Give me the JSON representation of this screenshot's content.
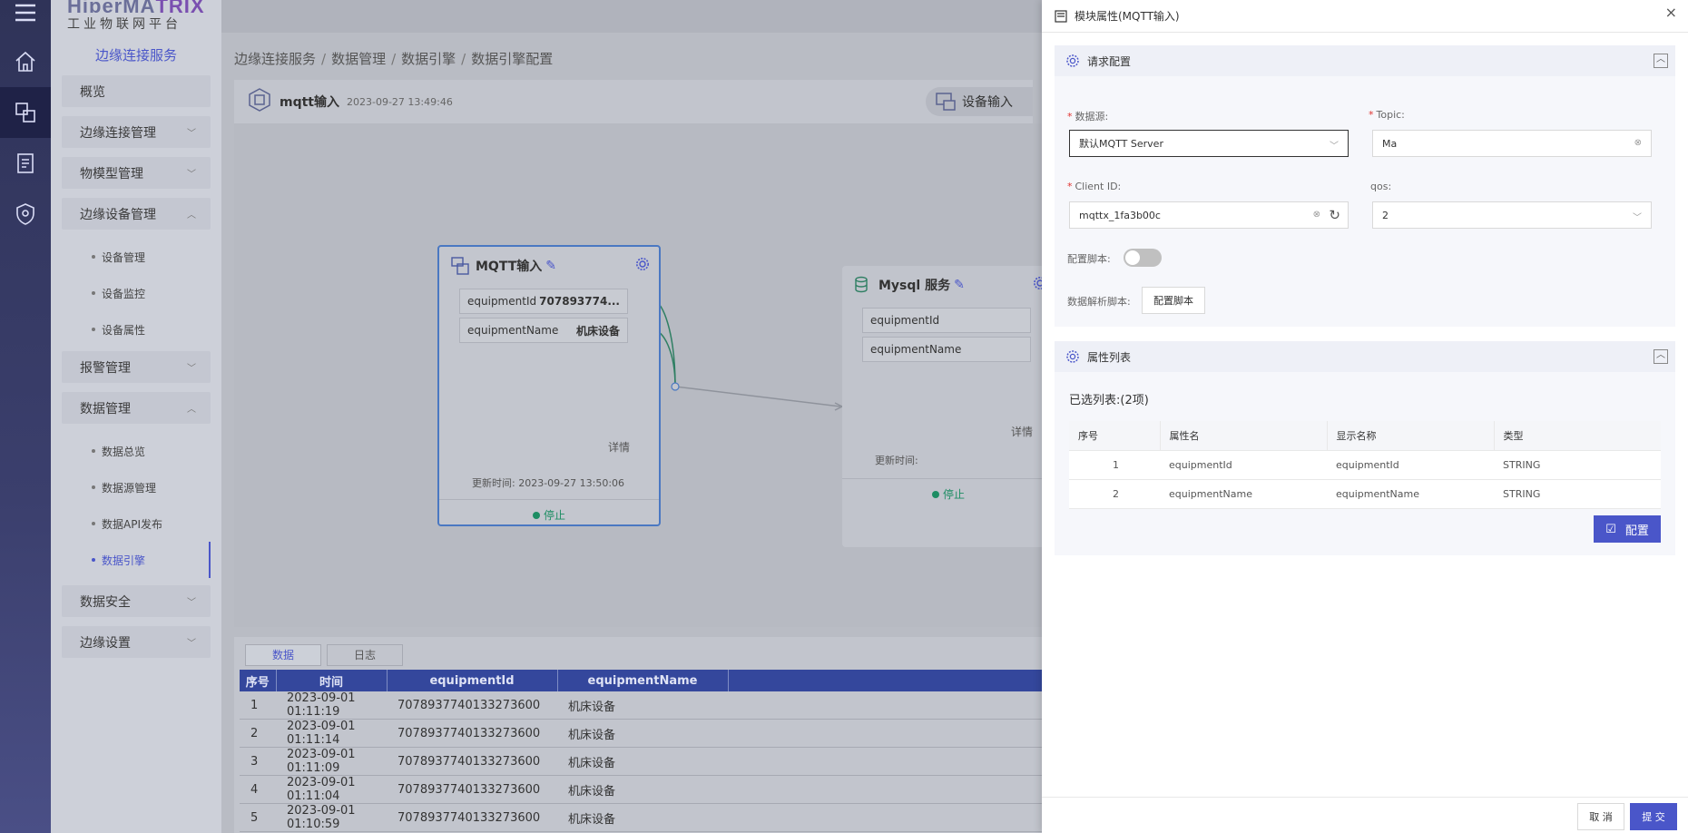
{
  "brand": {
    "logo_a": "HiperMA",
    "logo_b": "TRIX",
    "subtitle": "工业物联网平台"
  },
  "menu": {
    "title": "边缘连接服务",
    "overview": "概览",
    "edge_conn": "边缘连接管理",
    "model": "物模型管理",
    "edge_device": "边缘设备管理",
    "device_mgmt": "设备管理",
    "device_monitor": "设备监控",
    "device_attr": "设备属性",
    "alarm": "报警管理",
    "data": "数据管理",
    "data_overview": "数据总览",
    "datasource": "数据源管理",
    "api": "数据API发布",
    "engine": "数据引擎",
    "security": "数据安全",
    "edge_settings": "边缘设置"
  },
  "breadcrumb": [
    "边缘连接服务",
    "数据管理",
    "数据引擎",
    "数据引擎配置"
  ],
  "breadcrumb_sep": "/",
  "flow": {
    "name": "mqtt输入",
    "time": "2023-09-27 13:49:46",
    "device_btn": "设备输入"
  },
  "mqtt_node": {
    "title": "MQTT输入",
    "rows": [
      {
        "k": "equipmentId",
        "v": "707893774..."
      },
      {
        "k": "equipmentName",
        "v": "机床设备"
      }
    ],
    "detail": "详情",
    "updated_label": "更新时间:",
    "updated": "2023-09-27 13:50:06",
    "status": "停止"
  },
  "mysql_node": {
    "title": "Mysql 服务",
    "rows": [
      {
        "k": "equipmentId"
      },
      {
        "k": "equipmentName"
      }
    ],
    "detail": "详情",
    "updated_label": "更新时间:",
    "status": "停止"
  },
  "bottom": {
    "tabs": [
      "数据",
      "日志"
    ],
    "columns": [
      "序号",
      "时间",
      "equipmentId",
      "equipmentName"
    ],
    "rows": [
      [
        "1",
        "2023-09-01 01:11:19",
        "7078937740133273600",
        "机床设备"
      ],
      [
        "2",
        "2023-09-01 01:11:14",
        "7078937740133273600",
        "机床设备"
      ],
      [
        "3",
        "2023-09-01 01:11:09",
        "7078937740133273600",
        "机床设备"
      ],
      [
        "4",
        "2023-09-01 01:11:04",
        "7078937740133273600",
        "机床设备"
      ],
      [
        "5",
        "2023-09-01 01:10:59",
        "7078937740133273600",
        "机床设备"
      ]
    ]
  },
  "drawer": {
    "title": "模块属性(MQTT输入)",
    "close": "×",
    "req_section": "请求配置",
    "datasource_label": "数据源:",
    "datasource_value": "默认MQTT Server",
    "topic_label": "Topic:",
    "topic_value": "Ma",
    "clientid_label": "Client ID:",
    "clientid_value": "mqttx_1fa3b00c",
    "qos_label": "qos:",
    "qos_value": "2",
    "script_label": "配置脚本:",
    "parse_label": "数据解析脚本:",
    "parse_btn": "配置脚本",
    "attr_section": "属性列表",
    "selected": "已选列表:(2项)",
    "attr_columns": [
      "序号",
      "属性名",
      "显示名称",
      "类型"
    ],
    "attr_rows": [
      [
        "1",
        "equipmentId",
        "equipmentId",
        "STRING"
      ],
      [
        "2",
        "equipmentName",
        "equipmentName",
        "STRING"
      ]
    ],
    "config_btn": "配置",
    "cancel": "取 消",
    "submit": "提 交"
  },
  "colors": {
    "accent": "#4a56c9",
    "status_green": "#1d8d63",
    "table_head": "#34479c"
  }
}
